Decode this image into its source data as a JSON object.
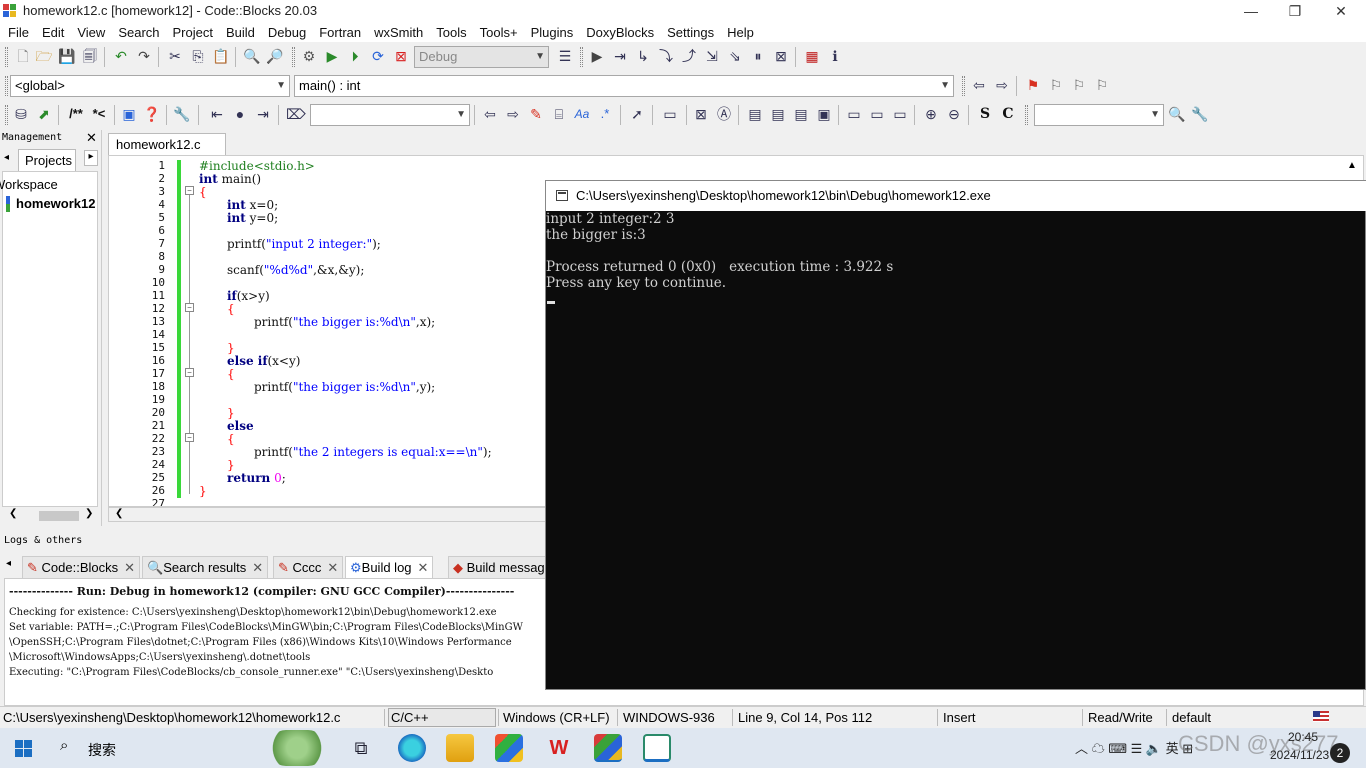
{
  "window": {
    "title": "homework12.c [homework12] - Code::Blocks 20.03",
    "minimize_glyph": "—",
    "restore_glyph": "❐",
    "close_glyph": "✕"
  },
  "menu": [
    "File",
    "Edit",
    "View",
    "Search",
    "Project",
    "Build",
    "Debug",
    "Fortran",
    "wxSmith",
    "Tools",
    "Tools+",
    "Plugins",
    "DoxyBlocks",
    "Settings",
    "Help"
  ],
  "toolbar": {
    "build_target": "Debug",
    "scope": "<global>",
    "function": "main() : int",
    "search_value": "",
    "search_value2": "",
    "doxy_labels": [
      "/**",
      "*<"
    ],
    "regex_label": ".*",
    "s_label": "S",
    "c_label": "C"
  },
  "management": {
    "title": "Management",
    "tab": "Projects",
    "workspace_label": "Workspace",
    "project_label": "homework12"
  },
  "editor": {
    "tab_label": "homework12.c",
    "lines": [
      {
        "n": "1"
      },
      {
        "n": "2"
      },
      {
        "n": "3"
      },
      {
        "n": "4"
      },
      {
        "n": "5"
      },
      {
        "n": "6"
      },
      {
        "n": "7"
      },
      {
        "n": "8"
      },
      {
        "n": "9"
      },
      {
        "n": "10"
      },
      {
        "n": "11"
      },
      {
        "n": "12"
      },
      {
        "n": "13"
      },
      {
        "n": "14"
      },
      {
        "n": "15"
      },
      {
        "n": "16"
      },
      {
        "n": "17"
      },
      {
        "n": "18"
      },
      {
        "n": "19"
      },
      {
        "n": "20"
      },
      {
        "n": "21"
      },
      {
        "n": "22"
      },
      {
        "n": "23"
      },
      {
        "n": "24"
      },
      {
        "n": "25"
      },
      {
        "n": "26"
      },
      {
        "n": "27"
      }
    ],
    "code": {
      "l1": "#include<stdio.h>",
      "l2_kw": "int",
      "l2_rest": " main()",
      "l3": "{",
      "l4_kw": "int",
      "l4_rest": " x=0;",
      "l5_kw": "int",
      "l5_rest": " y=0;",
      "l7_a": "printf(",
      "l7_s": "\"input 2 integer:\"",
      "l7_b": ");",
      "l9_a": "scanf(",
      "l9_s": "\"%d%d\"",
      "l9_b": ",&x,&y);",
      "l11_kw": "if",
      "l11_rest": "(x>y)",
      "l12": "{",
      "l13_a": "printf(",
      "l13_s": "\"the bigger is:%d\\n\"",
      "l13_b": ",x);",
      "l15": "}",
      "l16_kw": "else if",
      "l16_rest": "(x<y)",
      "l17": "{",
      "l18_a": "printf(",
      "l18_s": "\"the bigger is:%d\\n\"",
      "l18_b": ",y);",
      "l20": "}",
      "l21_kw": "else",
      "l22": "{",
      "l23_a": "printf(",
      "l23_s": "\"the 2 integers is equal:x==\\n\"",
      "l23_b": ");",
      "l24": "}",
      "l25_kw": "return",
      "l25_num": "0",
      "l25_b": ";",
      "l26": "}"
    }
  },
  "console": {
    "title": "C:\\Users\\yexinsheng\\Desktop\\homework12\\bin\\Debug\\homework12.exe",
    "lines": [
      "input 2 integer:2 3",
      "the bigger is:3",
      "",
      "Process returned 0 (0x0)   execution time : 3.922 s",
      "Press any key to continue."
    ]
  },
  "logs": {
    "title": "Logs & others",
    "tabs": [
      "Code::Blocks",
      "Search results",
      "Cccc",
      "Build log",
      "Build messag"
    ],
    "header": "-------------- Run: Debug in homework12 (compiler: GNU GCC Compiler)---------------",
    "lines": [
      "Checking for existence: C:\\Users\\yexinsheng\\Desktop\\homework12\\bin\\Debug\\homework12.exe",
      "Set variable: PATH=.;C:\\Program Files\\CodeBlocks\\MinGW\\bin;C:\\Program Files\\CodeBlocks\\MinGW",
      "\\OpenSSH;C:\\Program Files\\dotnet;C:\\Program Files (x86)\\Windows Kits\\10\\Windows Performance",
      "\\Microsoft\\WindowsApps;C:\\Users\\yexinsheng\\.dotnet\\tools",
      "Executing: \"C:\\Program Files\\CodeBlocks/cb_console_runner.exe\" \"C:\\Users\\yexinsheng\\Deskto"
    ]
  },
  "status": {
    "path": "C:\\Users\\yexinsheng\\Desktop\\homework12\\homework12.c",
    "language": "C/C++",
    "eol": "Windows (CR+LF)",
    "encoding": "WINDOWS-936",
    "position": "Line 9, Col 14, Pos 112",
    "mode": "Insert",
    "access": "Read/Write",
    "theme": "default"
  },
  "taskbar": {
    "search_label": "搜索",
    "tray": "英 ⊞",
    "watermark": "CSDN @yxs277",
    "time": "20:45",
    "date": "2024/11/23",
    "notifications": "2"
  }
}
